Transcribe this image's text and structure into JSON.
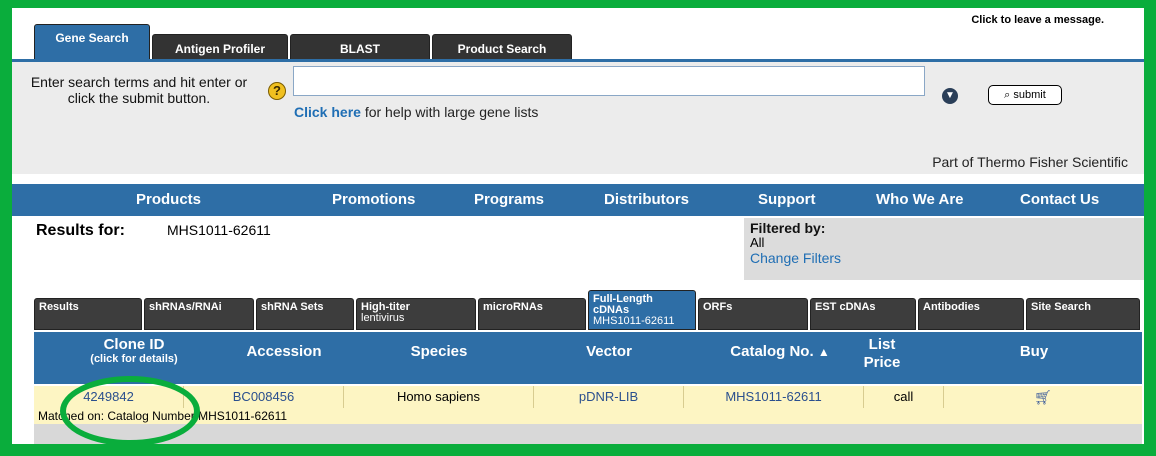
{
  "message_link": "Click to leave a message.",
  "top_tabs": [
    "Gene Search",
    "Antigen Profiler",
    "BLAST",
    "Product Search"
  ],
  "search": {
    "prompt": "Enter search terms and hit enter or click the submit button.",
    "value": "",
    "help_link": "Click here",
    "help_rest": " for help with large gene lists",
    "submit_label": "submit",
    "help_icon": "?"
  },
  "part_of": "Part of Thermo Fisher Scientific",
  "main_nav": [
    "Products",
    "Promotions",
    "Programs",
    "Distributors",
    "Support",
    "Who We Are",
    "Contact Us"
  ],
  "results": {
    "label": "Results for:",
    "query": "MHS1011-62611",
    "filter_title": "Filtered by:",
    "filter_value": "All",
    "change_filters": "Change Filters"
  },
  "result_tabs": [
    {
      "line1": "Results",
      "line2": ""
    },
    {
      "line1": "shRNAs/RNAi",
      "line2": ""
    },
    {
      "line1": "shRNA Sets",
      "line2": ""
    },
    {
      "line1": "High-titer",
      "line2": "lentivirus"
    },
    {
      "line1": "microRNAs",
      "line2": ""
    },
    {
      "line1": "Full-Length cDNAs",
      "line2": "MHS1011-62611"
    },
    {
      "line1": "ORFs",
      "line2": ""
    },
    {
      "line1": "EST cDNAs",
      "line2": ""
    },
    {
      "line1": "Antibodies",
      "line2": ""
    },
    {
      "line1": "Site Search",
      "line2": ""
    }
  ],
  "table": {
    "headers": {
      "clone_id": "Clone ID",
      "clone_id_sub": "(click for details)",
      "accession": "Accession",
      "species": "Species",
      "vector": "Vector",
      "catalog": "Catalog No.",
      "list_price": "List Price",
      "buy": "Buy"
    },
    "sort_indicator": "▲",
    "row": {
      "clone_id": "4249842",
      "accession": "BC008456",
      "species": "Homo sapiens",
      "vector": "pDNR-LIB",
      "catalog": "MHS1011-62611",
      "price": "call",
      "buy_icon": "cart-icon"
    },
    "match_text": "Matched on: Catalog Number MHS1011-62611"
  },
  "colors": {
    "highlight_green": "#0aad3c",
    "nav_blue": "#2e6ea6",
    "row_yellow": "#fdf5c3"
  }
}
